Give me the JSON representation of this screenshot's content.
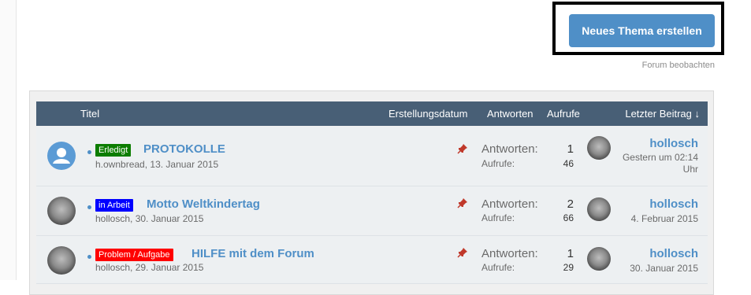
{
  "toolbar": {
    "new_topic_label": "Neues Thema erstellen",
    "watch_label": "Forum beobachten"
  },
  "list_header": {
    "title": "Titel",
    "created": "Erstellungsdatum",
    "replies": "Antworten",
    "views": "Aufrufe",
    "last_post": "Letzter Beitrag ↓"
  },
  "threads": [
    {
      "prefix": "Erledigt",
      "prefix_color": "#0c7d00",
      "title": "PROTOKOLLE",
      "author": "h.ownbread",
      "created": "13. Januar 2015",
      "replies_label": "Antworten:",
      "replies": "1",
      "views_label": "Aufrufe:",
      "views": "46",
      "last_user": "hollosch",
      "last_date": "Gestern um 02:14 Uhr"
    },
    {
      "prefix": "in Arbeit",
      "prefix_color": "#0000ff",
      "title": "Motto Weltkindertag",
      "author": "hollosch",
      "created": "30. Januar 2015",
      "replies_label": "Antworten:",
      "replies": "2",
      "views_label": "Aufrufe:",
      "views": "66",
      "last_user": "hollosch",
      "last_date": "4. Februar 2015"
    },
    {
      "prefix": "Problem / Aufgabe",
      "prefix_color": "#ff0000",
      "title": "HILFE mit dem Forum",
      "author": "hollosch",
      "created": "29. Januar 2015",
      "replies_label": "Antworten:",
      "replies": "1",
      "views_label": "Aufrufe:",
      "views": "29",
      "last_user": "hollosch",
      "last_date": "30. Januar 2015"
    }
  ],
  "icons": {
    "pin": "thumbtack-icon",
    "default_avatar": "user-icon",
    "sort": "arrow-down-icon"
  },
  "colors": {
    "accent": "#4f8fc7",
    "header_bg": "#485f76",
    "row_bg": "#edf0f2"
  }
}
